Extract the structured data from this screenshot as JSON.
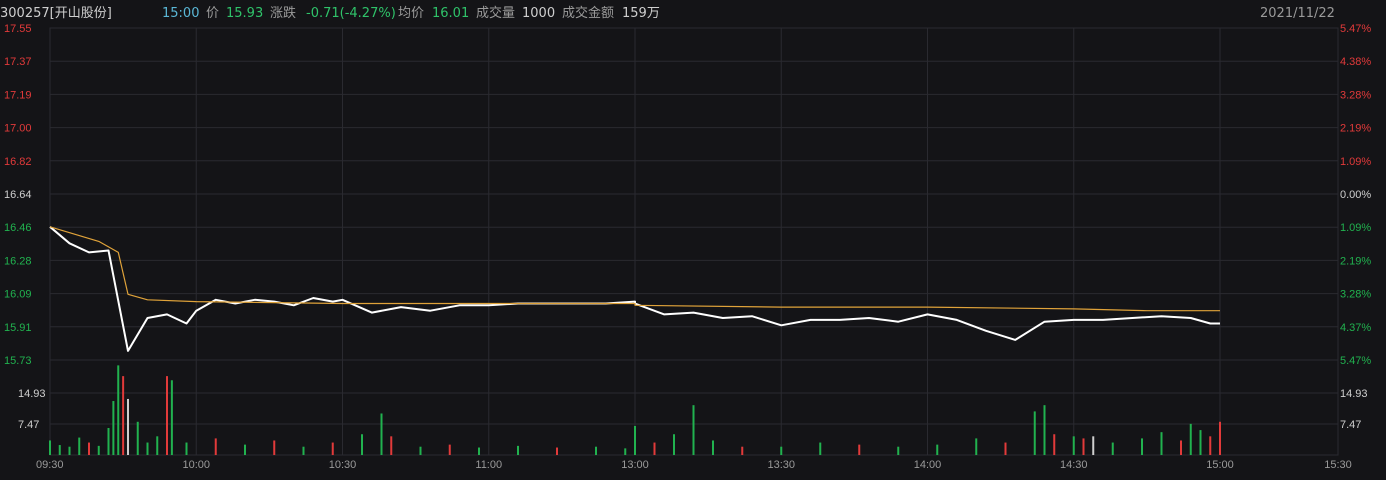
{
  "header": {
    "code_name": "300257[开山股份]",
    "time": "15:00",
    "price_label": "价",
    "price": "15.93",
    "change_label": "涨跌",
    "change": "-0.71(-4.27%)",
    "avg_label": "均价",
    "avg": "16.01",
    "volume_label": "成交量",
    "volume": "1000",
    "amount_label": "成交金额",
    "amount": "159万",
    "date": "2021/11/22"
  },
  "colors": {
    "background": "#141417",
    "grid": "#2a2a30",
    "price_line": "#ffffff",
    "avg_line": "#e0a33a",
    "up": "#e23a3a",
    "down": "#21b24f",
    "neutral_tick": "#cfcfcf"
  },
  "chart_data": {
    "type": "line",
    "title": "",
    "x_ticks": [
      "09:30",
      "10:00",
      "10:30",
      "11:00",
      "13:00",
      "13:30",
      "14:00",
      "14:30",
      "15:00",
      "15:30"
    ],
    "price_ticks_left": [
      "17.55",
      "17.37",
      "17.19",
      "17.00",
      "16.82",
      "16.64",
      "16.46",
      "16.28",
      "16.09",
      "15.91",
      "15.73"
    ],
    "pct_ticks_right": [
      "5.47%",
      "4.38%",
      "3.28%",
      "2.19%",
      "1.09%",
      "0.00%",
      "1.09%",
      "2.19%",
      "3.28%",
      "4.37%",
      "5.47%"
    ],
    "pct_tick_colors": [
      "up",
      "up",
      "up",
      "up",
      "up",
      "neutral",
      "down",
      "down",
      "down",
      "down",
      "down"
    ],
    "price_ylim": [
      15.73,
      17.55
    ],
    "prev_close": 16.64,
    "volume_ticks": [
      "14.93",
      "7.47"
    ],
    "volume_ylim": [
      0,
      22.4
    ],
    "series": [
      {
        "key": "price",
        "x": [
          "09:30",
          "09:34",
          "09:38",
          "09:42",
          "09:46",
          "09:50",
          "09:54",
          "09:58",
          "10:00",
          "10:04",
          "10:08",
          "10:12",
          "10:16",
          "10:20",
          "10:24",
          "10:28",
          "10:30",
          "10:36",
          "10:42",
          "10:48",
          "10:54",
          "11:00",
          "11:06",
          "11:12",
          "11:18",
          "11:24",
          "11:30",
          "13:00",
          "13:06",
          "13:12",
          "13:18",
          "13:24",
          "13:30",
          "13:36",
          "13:42",
          "13:48",
          "13:54",
          "14:00",
          "14:06",
          "14:12",
          "14:18",
          "14:24",
          "14:30",
          "14:36",
          "14:42",
          "14:48",
          "14:54",
          "14:58",
          "15:00"
        ],
        "values": [
          16.46,
          16.37,
          16.32,
          16.33,
          15.78,
          15.96,
          15.98,
          15.93,
          16.0,
          16.06,
          16.04,
          16.06,
          16.05,
          16.03,
          16.07,
          16.05,
          16.06,
          15.99,
          16.02,
          16.0,
          16.03,
          16.03,
          16.04,
          16.04,
          16.04,
          16.04,
          16.05,
          16.04,
          15.98,
          15.99,
          15.96,
          15.97,
          15.92,
          15.95,
          15.95,
          15.96,
          15.94,
          15.98,
          15.95,
          15.89,
          15.84,
          15.94,
          15.95,
          15.95,
          15.96,
          15.97,
          15.96,
          15.93,
          15.93
        ]
      },
      {
        "key": "avg",
        "x": [
          "09:30",
          "09:40",
          "09:44",
          "09:46",
          "09:50",
          "10:00",
          "10:30",
          "11:00",
          "11:30",
          "13:00",
          "13:30",
          "14:00",
          "14:30",
          "14:45",
          "15:00"
        ],
        "values": [
          16.46,
          16.38,
          16.32,
          16.09,
          16.06,
          16.05,
          16.04,
          16.04,
          16.04,
          16.03,
          16.02,
          16.02,
          16.01,
          16.0,
          16.0
        ]
      }
    ],
    "volume": [
      {
        "t": "09:30",
        "v": 3.5,
        "d": "down"
      },
      {
        "t": "09:32",
        "v": 2.4,
        "d": "down"
      },
      {
        "t": "09:34",
        "v": 2.0,
        "d": "down"
      },
      {
        "t": "09:36",
        "v": 4.2,
        "d": "down"
      },
      {
        "t": "09:38",
        "v": 3.0,
        "d": "up"
      },
      {
        "t": "09:40",
        "v": 2.2,
        "d": "down"
      },
      {
        "t": "09:42",
        "v": 6.5,
        "d": "down"
      },
      {
        "t": "09:43",
        "v": 13.0,
        "d": "down"
      },
      {
        "t": "09:44",
        "v": 21.6,
        "d": "down"
      },
      {
        "t": "09:45",
        "v": 19.0,
        "d": "up"
      },
      {
        "t": "09:46",
        "v": 13.5,
        "d": "neutral"
      },
      {
        "t": "09:48",
        "v": 8.0,
        "d": "down"
      },
      {
        "t": "09:50",
        "v": 3.0,
        "d": "down"
      },
      {
        "t": "09:52",
        "v": 4.5,
        "d": "down"
      },
      {
        "t": "09:54",
        "v": 19.0,
        "d": "up"
      },
      {
        "t": "09:55",
        "v": 18.0,
        "d": "down"
      },
      {
        "t": "09:58",
        "v": 3.0,
        "d": "down"
      },
      {
        "t": "10:04",
        "v": 4.0,
        "d": "up"
      },
      {
        "t": "10:10",
        "v": 2.5,
        "d": "down"
      },
      {
        "t": "10:16",
        "v": 3.5,
        "d": "up"
      },
      {
        "t": "10:22",
        "v": 2.0,
        "d": "down"
      },
      {
        "t": "10:28",
        "v": 3.0,
        "d": "up"
      },
      {
        "t": "10:34",
        "v": 5.0,
        "d": "down"
      },
      {
        "t": "10:38",
        "v": 10.0,
        "d": "down"
      },
      {
        "t": "10:40",
        "v": 4.5,
        "d": "up"
      },
      {
        "t": "10:46",
        "v": 2.0,
        "d": "down"
      },
      {
        "t": "10:52",
        "v": 2.5,
        "d": "up"
      },
      {
        "t": "10:58",
        "v": 1.8,
        "d": "down"
      },
      {
        "t": "11:06",
        "v": 2.2,
        "d": "down"
      },
      {
        "t": "11:14",
        "v": 1.8,
        "d": "up"
      },
      {
        "t": "11:22",
        "v": 2.0,
        "d": "down"
      },
      {
        "t": "11:28",
        "v": 1.6,
        "d": "down"
      },
      {
        "t": "13:00",
        "v": 7.0,
        "d": "down"
      },
      {
        "t": "13:04",
        "v": 3.0,
        "d": "up"
      },
      {
        "t": "13:08",
        "v": 5.0,
        "d": "down"
      },
      {
        "t": "13:12",
        "v": 12.0,
        "d": "down"
      },
      {
        "t": "13:16",
        "v": 3.5,
        "d": "down"
      },
      {
        "t": "13:22",
        "v": 2.0,
        "d": "up"
      },
      {
        "t": "13:30",
        "v": 2.0,
        "d": "down"
      },
      {
        "t": "13:38",
        "v": 3.0,
        "d": "down"
      },
      {
        "t": "13:46",
        "v": 2.5,
        "d": "up"
      },
      {
        "t": "13:54",
        "v": 2.0,
        "d": "down"
      },
      {
        "t": "14:02",
        "v": 2.5,
        "d": "down"
      },
      {
        "t": "14:10",
        "v": 4.0,
        "d": "down"
      },
      {
        "t": "14:16",
        "v": 3.0,
        "d": "up"
      },
      {
        "t": "14:22",
        "v": 10.5,
        "d": "down"
      },
      {
        "t": "14:24",
        "v": 12.0,
        "d": "down"
      },
      {
        "t": "14:26",
        "v": 5.0,
        "d": "up"
      },
      {
        "t": "14:30",
        "v": 4.5,
        "d": "down"
      },
      {
        "t": "14:32",
        "v": 4.0,
        "d": "up"
      },
      {
        "t": "14:34",
        "v": 4.5,
        "d": "neutral"
      },
      {
        "t": "14:38",
        "v": 3.0,
        "d": "down"
      },
      {
        "t": "14:44",
        "v": 4.0,
        "d": "down"
      },
      {
        "t": "14:48",
        "v": 5.5,
        "d": "down"
      },
      {
        "t": "14:52",
        "v": 3.5,
        "d": "up"
      },
      {
        "t": "14:54",
        "v": 7.5,
        "d": "down"
      },
      {
        "t": "14:56",
        "v": 6.0,
        "d": "down"
      },
      {
        "t": "14:58",
        "v": 4.5,
        "d": "up"
      },
      {
        "t": "15:00",
        "v": 8.0,
        "d": "up"
      }
    ]
  }
}
